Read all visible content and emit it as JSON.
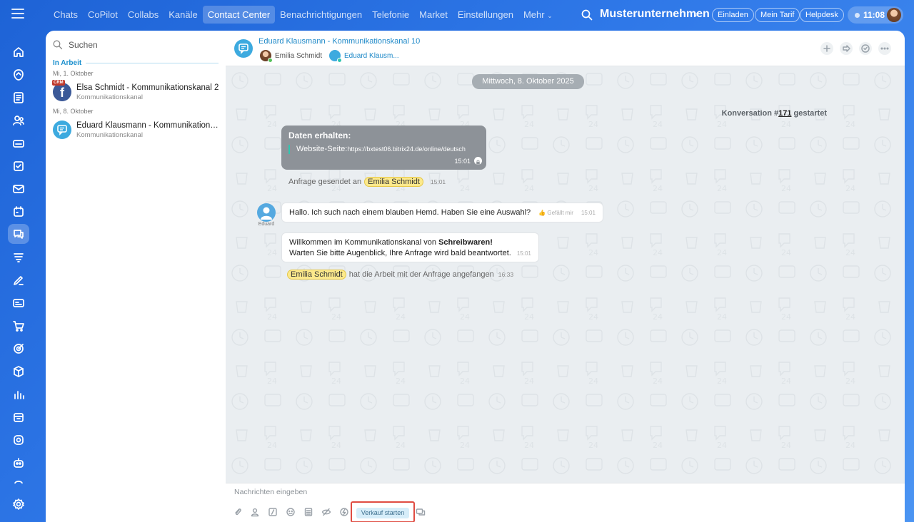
{
  "topbar": {
    "nav": [
      "Chats",
      "CoPilot",
      "Collabs",
      "Kanäle",
      "Contact Center",
      "Benachrichtigungen",
      "Telefonie",
      "Market",
      "Einstellungen",
      "Mehr"
    ],
    "active_nav": "Contact Center",
    "company": "Musterunternehmen",
    "invite_label": "Einladen",
    "tariff_label": "Mein Tarif",
    "helpdesk_label": "Helpdesk",
    "time": "11:08"
  },
  "leftpanel": {
    "search_label": "Suchen",
    "section_title": "In Arbeit",
    "groups": [
      {
        "date": "Mi, 1. Oktober",
        "items": [
          {
            "title": "Elsa Schmidt - Kommunikationskanal 2",
            "subtitle": "Kommunikationskanal",
            "badge": "CRM",
            "avatar_icon": "facebook-icon"
          }
        ]
      },
      {
        "date": "Mi, 8. Oktober",
        "items": [
          {
            "title": "Eduard Klausmann - Kommunikationskanal 10",
            "subtitle": "Kommunikationskanal",
            "avatar_icon": "chat-bubble-icon"
          }
        ]
      }
    ]
  },
  "chat": {
    "title": "Eduard Klausmann - Kommunikationskanal 10",
    "members": [
      {
        "name": "Emilia Schmidt"
      },
      {
        "name": "Eduard Klausm..."
      }
    ],
    "date_divider": "Mittwoch, 8. Oktober 2025",
    "conversation": {
      "prefix": "Konversation #",
      "number": "171",
      "suffix": " gestartet"
    },
    "data_message": {
      "title": "Daten erhalten:",
      "label": "Website-Seite:",
      "url": "https://bxtest06.bitrix24.de/online/deutsch",
      "time": "15:01"
    },
    "request_sent": {
      "text": "Anfrage gesendet an",
      "name": "Emilia Schmidt",
      "time": "15:01"
    },
    "user_message": {
      "sender": "Eduard",
      "text": "Hallo. Ich such nach einem blauben Hemd. Haben Sie eine Auswahl?",
      "like": "Gefällt mir",
      "time": "15:01"
    },
    "welcome_message": {
      "line1_prefix": "Willkommen im Kommunikationskanal von ",
      "line1_bold": "Schreibwaren!",
      "line2": "Warten Sie bitte Augenblick, Ihre Anfrage wird bald beantwortet.",
      "time": "15:01"
    },
    "work_started": {
      "name": "Emilia Schmidt",
      "text": "hat die Arbeit mit der Anfrage angefangen",
      "time": "16:33"
    },
    "input_placeholder": "Nachrichten eingeben",
    "sale_button": "Verkauf starten"
  },
  "colors": {
    "accent": "#1e89c8",
    "highlight": "#e04c42",
    "name_tag": "#fce98c"
  }
}
